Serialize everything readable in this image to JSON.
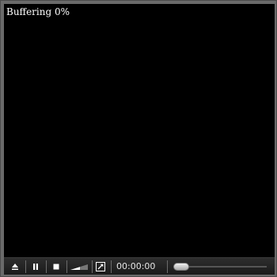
{
  "video": {
    "status_text": "Buffering 0%",
    "background": "#000000"
  },
  "controls": {
    "eject_icon": "eject-icon",
    "pause_icon": "pause-icon",
    "stop_icon": "stop-icon",
    "volume_icon": "volume-ramp-icon",
    "fullscreen_icon": "fullscreen-arrow-icon",
    "time": "00:00:00",
    "seek_position": 0
  },
  "colors": {
    "frame": "#6a6a6a",
    "control_bar": "#222222",
    "icon": "#ffffff"
  }
}
